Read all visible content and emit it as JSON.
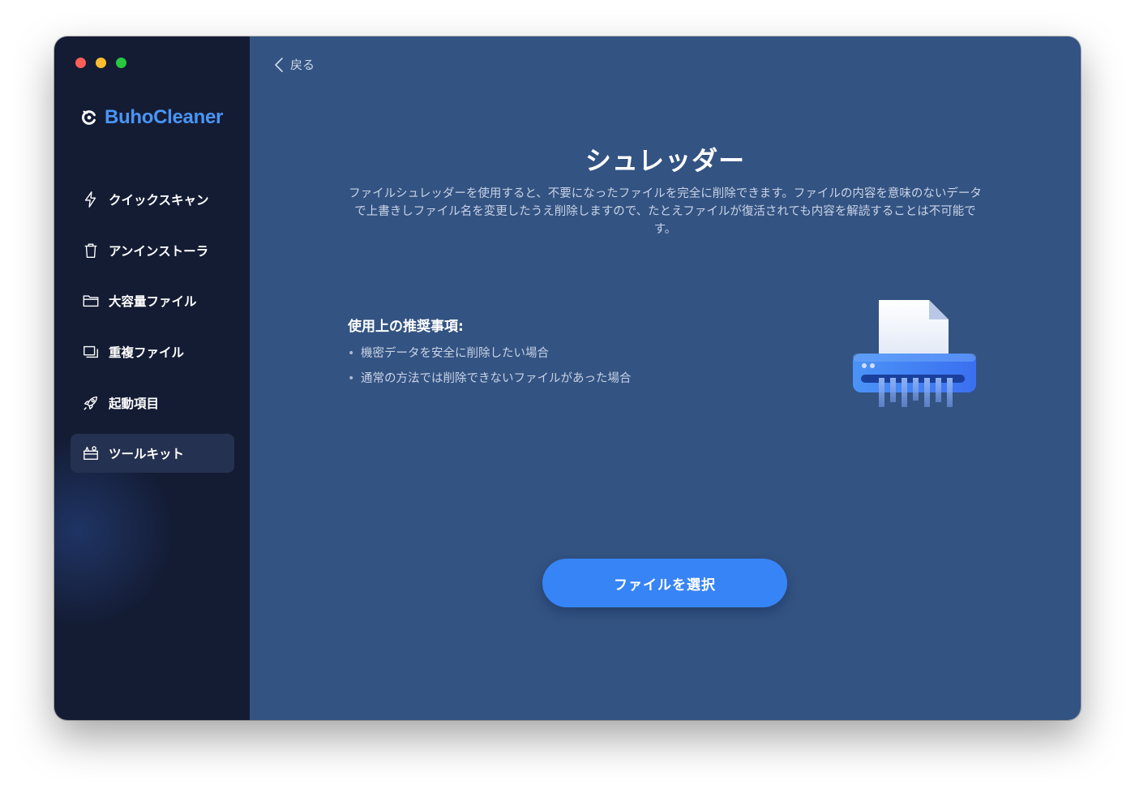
{
  "app": {
    "name": "BuhoCleaner",
    "brand_color": "#4a95f5"
  },
  "window_controls": {
    "close_color": "#ff5f57",
    "minimize_color": "#febc2e",
    "zoom_color": "#28c840"
  },
  "sidebar": {
    "items": [
      {
        "label": "クイックスキャン",
        "icon": "lightning-icon",
        "active": false
      },
      {
        "label": "アンインストーラ",
        "icon": "trash-icon",
        "active": false
      },
      {
        "label": "大容量ファイル",
        "icon": "folder-icon",
        "active": false
      },
      {
        "label": "重複ファイル",
        "icon": "duplicate-icon",
        "active": false
      },
      {
        "label": "起動項目",
        "icon": "rocket-icon",
        "active": false
      },
      {
        "label": "ツールキット",
        "icon": "toolkit-icon",
        "active": true
      }
    ]
  },
  "main": {
    "back_label": "戻る",
    "title": "シュレッダー",
    "description": "ファイルシュレッダーを使用すると、不要になったファイルを完全に削除できます。ファイルの内容を意味のないデータで上書きしファイル名を変更したうえ削除しますので、たとえファイルが復活されても内容を解読することは不可能です。",
    "recommend_heading": "使用上の推奨事項:",
    "recommendations": [
      "機密データを安全に削除したい場合",
      "通常の方法では削除できないファイルがあった場合"
    ],
    "illustration": "shredder-icon",
    "select_button_label": "ファイルを選択",
    "accent_color": "#3784f6"
  }
}
